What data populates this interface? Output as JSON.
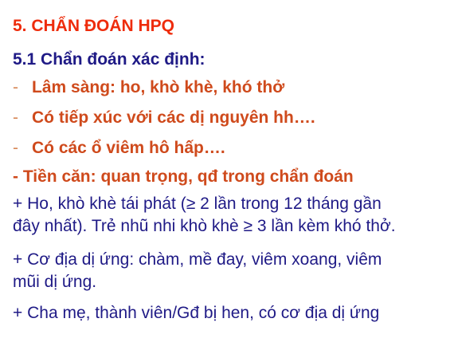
{
  "slide": {
    "title": "5. CHẨN ĐOÁN HPQ",
    "subtitle": "5.1 Chẩn đoán xác định:",
    "dash_bullets": [
      {
        "marker": "-",
        "text": "Lâm sàng: ho, khò khè, khó thở"
      },
      {
        "marker": "-",
        "text": "Có tiếp xúc với các dị nguyên hh…."
      },
      {
        "marker": "-",
        "text": "Có các ổ viêm hô hấp…."
      }
    ],
    "history_line": "- Tiền căn: quan trọng, qđ trong chẩn đoán",
    "plus_items": [
      "+ Ho, khò khè tái phát (≥ 2 lần trong 12 tháng gần",
      "đây nhất). Trẻ nhũ nhi khò khè ≥ 3 lần kèm khó thở.",
      "+ Cơ địa dị ứng: chàm, mề đay, viêm xoang, viêm",
      "mũi dị ứng.",
      "+ Cha mẹ, thành viên/Gđ bị hen, có cơ địa dị ứng"
    ]
  },
  "colors": {
    "title": "#ee2c0c",
    "heading": "#1f1a86",
    "bullet": "#cf4a1c",
    "body": "#1f1a86"
  }
}
